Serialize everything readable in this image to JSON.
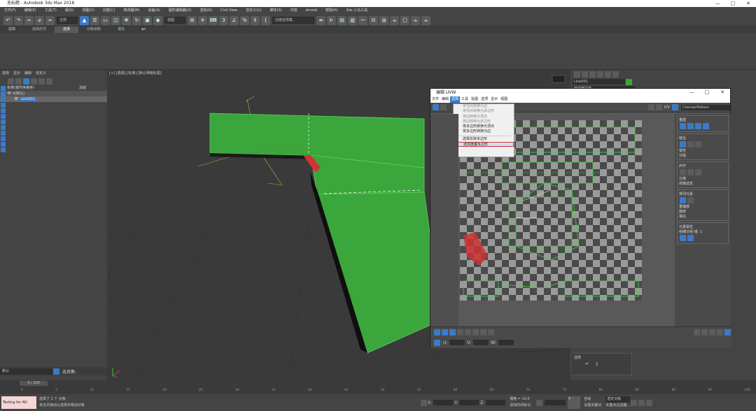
{
  "app": {
    "title": "无标题 - Autodesk 3ds Max 2018",
    "window_controls": [
      "—",
      "□",
      "✕"
    ]
  },
  "menubar": [
    "文件(F)",
    "编辑(E)",
    "工具(T)",
    "组(G)",
    "视图(V)",
    "创建(C)",
    "修改器(M)",
    "动画(A)",
    "图形编辑器(D)",
    "渲染(R)",
    "Civil View",
    "自定义(U)",
    "脚本(S)",
    "内容",
    "Arnold",
    "帮助(H)",
    "3ds 小马工具"
  ],
  "toolbar": {
    "selection_filter": "全部",
    "view_combo": "视图",
    "named_selection": "创建选择集"
  },
  "ribbon_tabs": [
    "建模",
    "自由形式",
    "选择",
    "对象绘制",
    "填充"
  ],
  "ribbon_active": "选择",
  "left_panel": {
    "menu": [
      "选择",
      "显示",
      "编辑",
      "自定义"
    ],
    "header": "名称(按升序排序)",
    "col2": "冻结",
    "items": [
      "0(默认)",
      "Line001"
    ]
  },
  "viewport": {
    "label": "[+] [透视] [标准] [默认明暗处理]"
  },
  "uv_editor": {
    "title": "编辑 UVW",
    "menu": [
      "文件",
      "编辑",
      "选择",
      "工具",
      "贴图",
      "选项",
      "显示",
      "视图"
    ],
    "active_menu": "选择",
    "dropdown_items": [
      {
        "label": "将顶点转换为边",
        "enabled": false
      },
      {
        "label": "将顶点转换为多边形",
        "enabled": false
      },
      {
        "label": "将边转换为顶点",
        "enabled": false
      },
      {
        "label": "将边转换为多边形",
        "enabled": false
      },
      {
        "label": "将多边形转换为顶点",
        "enabled": true
      },
      {
        "label": "将多边形转换为边",
        "enabled": true
      },
      {
        "label": "选择反转多边形",
        "enabled": true
      },
      {
        "label": "选择重叠多边形",
        "enabled": true,
        "highlighted": true
      }
    ],
    "uv_label": "UV",
    "checker_combo": "CheckerPattern",
    "side_sections": [
      {
        "title": "重建",
        "rows": [
          "",
          ""
        ]
      },
      {
        "title": "缝合",
        "rows": [
          "变形",
          "分组"
        ]
      },
      {
        "title": "炸开",
        "rows": [
          "分离",
          "焊接选定"
        ]
      },
      {
        "title": "排列元素",
        "rows": [
          "重缩放",
          "旋转",
          "填充"
        ]
      },
      {
        "title": "元素属性",
        "rows": [
          "组细分组 组: 1"
        ]
      }
    ],
    "bottom_labels": [
      "U:",
      "V:",
      "W:"
    ]
  },
  "right_panel": {
    "name": "Line001",
    "modifier_list": "修改器列表",
    "section_title": "选择"
  },
  "timeline": {
    "frame_display": "0 / 100",
    "ticks": [
      "0",
      "5",
      "10",
      "15",
      "20",
      "25",
      "30",
      "35",
      "40",
      "45",
      "50",
      "55",
      "60",
      "65",
      "70",
      "75",
      "80",
      "85",
      "90",
      "95",
      "100"
    ]
  },
  "statusbar": {
    "script_text": "Testing for AD",
    "status1": "选择了 1 个 对象",
    "status2": "单击并拖动以选择并移动对象",
    "x_label": "X:",
    "y_label": "Y:",
    "z_label": "Z:",
    "grid": "栅格 = 10.0",
    "add_time_tag": "添加时间标记",
    "auto_key": "自动",
    "set_key": "设置关键点",
    "selected": "选定对象",
    "key_filters": "关键点过滤器..."
  },
  "left_bottom": {
    "layer": "默认",
    "selection_set": "选择集:"
  },
  "colors": {
    "accent": "#3a7bc8",
    "model_green": "#3ba63b",
    "highlight_red": "#d33333"
  }
}
